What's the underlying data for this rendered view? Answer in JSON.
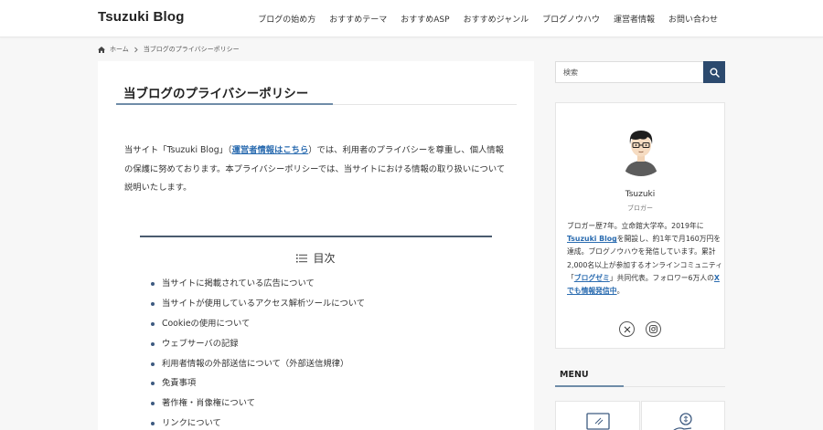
{
  "header": {
    "logo": "Tsuzuki Blog",
    "nav": [
      "ブログの始め方",
      "おすすめテーマ",
      "おすすめASP",
      "おすすめジャンル",
      "ブログノウハウ",
      "運営者情報",
      "お問い合わせ"
    ]
  },
  "breadcrumb": {
    "home": "ホーム",
    "current": "当ブログのプライバシーポリシー"
  },
  "article": {
    "title": "当ブログのプライバシーポリシー",
    "intro_pre": "当サイト「Tsuzuki Blog」（",
    "intro_link": "運営者情報はこちら",
    "intro_post": "）では、利用者のプライバシーを尊重し、個人情報の保護に努めております。本プライバシーポリシーでは、当サイトにおける情報の取り扱いについて説明いたします。",
    "toc_title": "目次",
    "toc_items": [
      "当サイトに掲載されている広告について",
      "当サイトが使用しているアクセス解析ツールについて",
      "Cookieの使用について",
      "ウェブサーバの記録",
      "利用者情報の外部送信について（外部送信規律）",
      "免責事項",
      "著作権・肖像権について",
      "リンクについて"
    ]
  },
  "sidebar": {
    "search_placeholder": "検索",
    "profile": {
      "name": "Tsuzuki",
      "role": "ブロガー",
      "bio_1": "ブロガー歴7年。立命館大学卒。2019年に",
      "bio_link1": "Tsuzuki Blog",
      "bio_2": "を開設し、約1年で月160万円を達成。ブログノウハウを発信しています。累計2,000名以上が参加するオンラインコミュニティ「",
      "bio_link2": "ブログゼミ",
      "bio_3": "」共同代表。フォロワー6万人の",
      "bio_link3": "Xでも情報発信中",
      "bio_4": "。"
    },
    "menu_title": "MENU"
  },
  "colors": {
    "accent": "#6f8ca8",
    "search_button": "#2c4a6e",
    "link": "#2b6cb0"
  }
}
